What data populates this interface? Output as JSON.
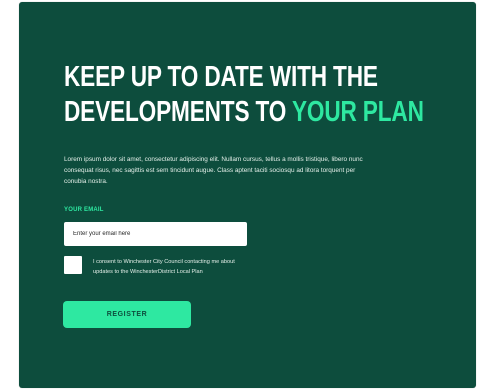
{
  "hero": {
    "title_line1": "KEEP UP TO DATE WITH THE",
    "title_line2_plain": "DEVELOPMENTS TO ",
    "title_line2_accent": "YOUR PLAN",
    "body": "Lorem ipsum dolor sit amet, consectetur adipiscing elit. Nullam cursus, tellus a mollis tristique, libero nunc consequat risus, nec sagittis est sem tincidunt augue. Class aptent taciti sociosqu ad litora torquent per conubia nostra."
  },
  "form": {
    "email_label": "YOUR EMAIL",
    "email_placeholder": "Enter your email here",
    "email_value": "",
    "consent_checked": false,
    "consent_text": "I consent to Winchester City Council contacting me about updates to the WinchesterDistrict Local Plan",
    "register_label": "REGISTER"
  },
  "colors": {
    "background": "#0d4d3d",
    "accent": "#2ee8a1",
    "text": "#ffffff"
  }
}
